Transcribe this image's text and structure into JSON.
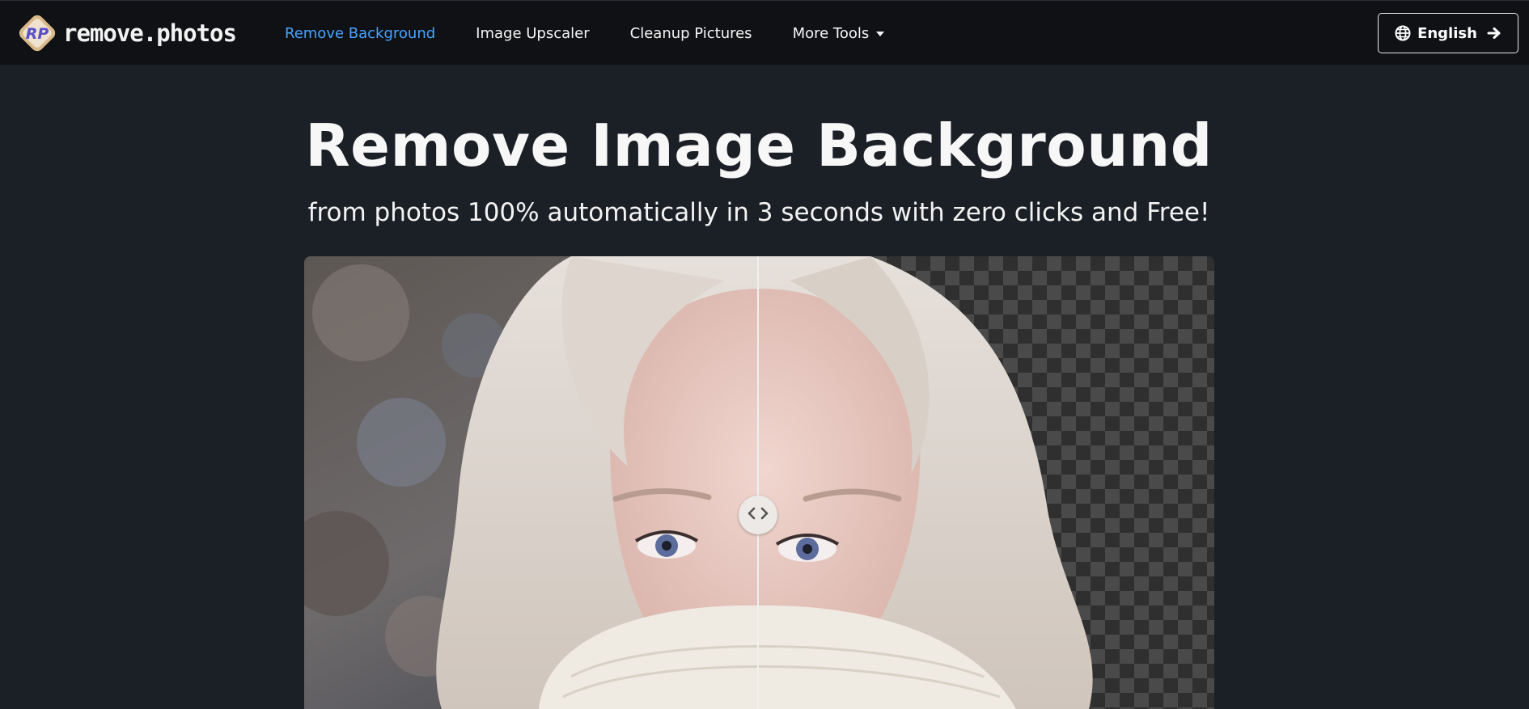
{
  "brand": {
    "name": "remove.photos",
    "logo_text": "RP"
  },
  "nav": {
    "items": [
      {
        "label": "Remove Background",
        "active": true
      },
      {
        "label": "Image Upscaler"
      },
      {
        "label": "Cleanup Pictures"
      },
      {
        "label": "More Tools",
        "dropdown": true
      }
    ]
  },
  "language": {
    "label": "English",
    "icon": "globe-icon",
    "action_icon": "arrow-right-icon"
  },
  "hero": {
    "title": "Remove Image Background",
    "subtitle": "from photos 100% automatically in 3 seconds with zero clicks and Free!"
  },
  "compare": {
    "handle_icon": "chevrons-left-right-icon",
    "split_position": 0.5
  },
  "colors": {
    "background": "#1b2027",
    "navbar": "#0f1114",
    "active_link": "#4aa3ff",
    "logo_gold": "#d9b98a",
    "logo_purple": "#5b4fc9"
  }
}
